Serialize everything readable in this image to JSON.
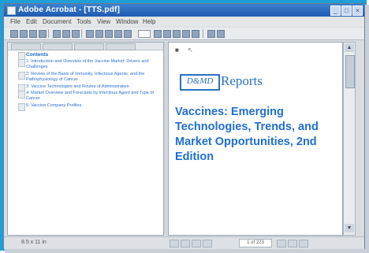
{
  "window": {
    "title": "Adobe Acrobat - [TTS.pdf]",
    "controls": [
      "_",
      "□",
      "×"
    ]
  },
  "menu": [
    "File",
    "Edit",
    "Document",
    "Tools",
    "View",
    "Window",
    "Help"
  ],
  "navigation": {
    "heading": "Contents",
    "items": [
      "1: Introduction and Overview of the Vaccine Market: Drivers and Challenges",
      "2: Review of the Basis of Immunity, Infectious Agents, and the Pathophysiology of Cancer",
      "3: Vaccine Technologies and Routes of Administration",
      "4: Market Overview and Forecasts by Infectious Agent and Type of Cancer",
      "5: Vaccine Company Profiles"
    ]
  },
  "document": {
    "logo_text": "D&MD",
    "reports_label": "Reports",
    "title": "Vaccines: Emerging Technologies, Trends, and Market Opportunities, 2nd Edition"
  },
  "status": {
    "left_text": "8.5 x 11 in",
    "page": "1 of 223"
  },
  "colors": {
    "frame_accent": "#1e9fd8",
    "title_bar": "#1f5bb0",
    "link_blue": "#2a6fd1",
    "doc_title_blue": "#1f6fd0"
  }
}
